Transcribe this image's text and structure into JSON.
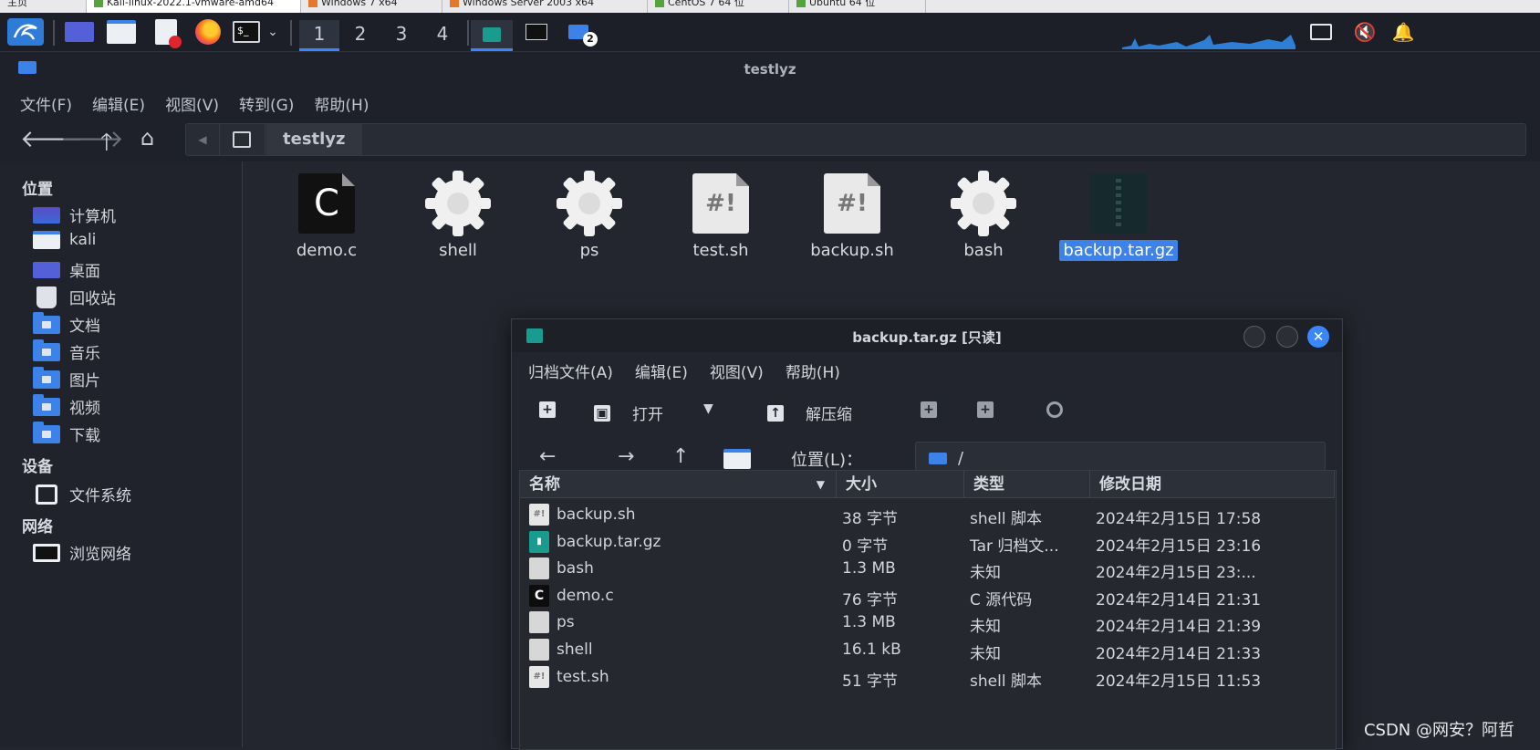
{
  "vm_tabs": [
    "主页",
    "Kali-linux-2022.1-vmware-amd64",
    "Windows 7 x64",
    "Windows Server 2003 x64",
    "CentOS 7 64 位",
    "Ubuntu 64 位"
  ],
  "workspaces": [
    "1",
    "2",
    "3",
    "4"
  ],
  "panel": {
    "badge_count": "2"
  },
  "window": {
    "title": "testlyz"
  },
  "menu": [
    "文件(F)",
    "编辑(E)",
    "视图(V)",
    "转到(G)",
    "帮助(H)"
  ],
  "location": {
    "crumb": "testlyz"
  },
  "sidebar": {
    "sections": [
      {
        "title": "位置",
        "items": [
          "计算机",
          "kali",
          "桌面",
          "回收站",
          "文档",
          "音乐",
          "图片",
          "视频",
          "下载"
        ]
      },
      {
        "title": "设备",
        "items": [
          "文件系统"
        ]
      },
      {
        "title": "网络",
        "items": [
          "浏览网络"
        ]
      }
    ]
  },
  "files": [
    {
      "name": "demo.c",
      "icon": "c-source-icon"
    },
    {
      "name": "shell",
      "icon": "gear-icon"
    },
    {
      "name": "ps",
      "icon": "gear-icon"
    },
    {
      "name": "test.sh",
      "icon": "script-icon"
    },
    {
      "name": "backup.sh",
      "icon": "script-icon"
    },
    {
      "name": "bash",
      "icon": "gear-icon"
    },
    {
      "name": "backup.tar.gz",
      "icon": "archive-icon",
      "selected": true
    }
  ],
  "archive_dialog": {
    "title": "backup.tar.gz [只读]",
    "menu": [
      "归档文件(A)",
      "编辑(E)",
      "视图(V)",
      "帮助(H)"
    ],
    "toolbar": {
      "open": "打开",
      "extract": "解压缩"
    },
    "location_label": "位置(L)：",
    "location_value": "/",
    "columns": [
      "名称",
      "大小",
      "类型",
      "修改日期"
    ],
    "rows": [
      {
        "name": "backup.sh",
        "size": "38 字节",
        "type": "shell 脚本",
        "date": "2024年2月15日 17:58",
        "icon": "script"
      },
      {
        "name": "backup.tar.gz",
        "size": "0 字节",
        "type": "Tar 归档文...",
        "date": "2024年2月15日 23:16",
        "icon": "archive"
      },
      {
        "name": "bash",
        "size": "1.3 MB",
        "type": "未知",
        "date": "2024年2月15日 23:...",
        "icon": "unknown"
      },
      {
        "name": "demo.c",
        "size": "76 字节",
        "type": "C 源代码",
        "date": "2024年2月14日 21:31",
        "icon": "c"
      },
      {
        "name": "ps",
        "size": "1.3 MB",
        "type": "未知",
        "date": "2024年2月14日 21:39",
        "icon": "unknown"
      },
      {
        "name": "shell",
        "size": "16.1 kB",
        "type": "未知",
        "date": "2024年2月14日 21:33",
        "icon": "unknown"
      },
      {
        "name": "test.sh",
        "size": "51 字节",
        "type": "shell 脚本",
        "date": "2024年2月15日 11:53",
        "icon": "script"
      }
    ]
  },
  "watermark": "CSDN @网安？阿哲",
  "colors": {
    "accent": "#3a86ff",
    "selection": "#3d82e8",
    "panel_bg": "#1c1f27"
  }
}
